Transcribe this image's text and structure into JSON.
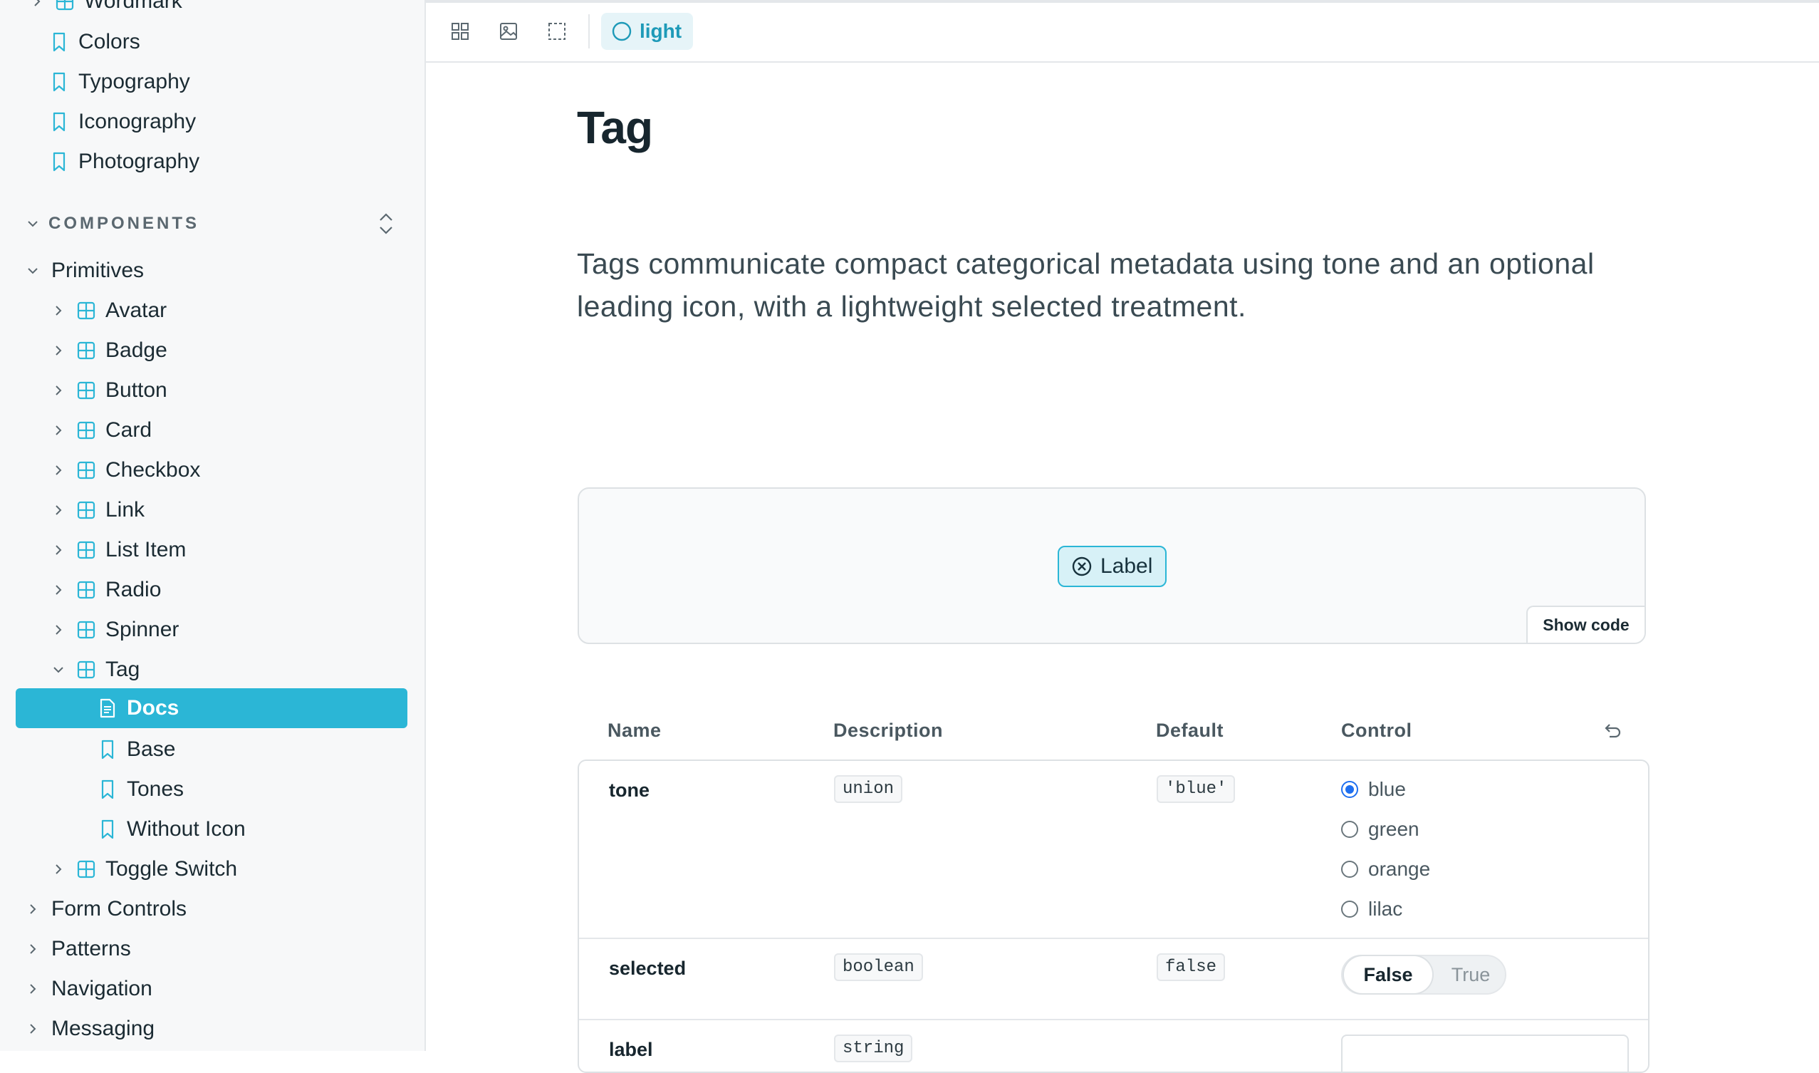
{
  "sidebar": {
    "top_items": [
      {
        "label": "Wordmark"
      },
      {
        "label": "Colors"
      },
      {
        "label": "Typography"
      },
      {
        "label": "Iconography"
      },
      {
        "label": "Photography"
      }
    ],
    "section_label": "COMPONENTS",
    "groups": [
      {
        "label": "Primitives"
      }
    ],
    "primitives": [
      {
        "label": "Avatar"
      },
      {
        "label": "Badge"
      },
      {
        "label": "Button"
      },
      {
        "label": "Card"
      },
      {
        "label": "Checkbox"
      },
      {
        "label": "Link"
      },
      {
        "label": "List Item"
      },
      {
        "label": "Radio"
      },
      {
        "label": "Spinner"
      },
      {
        "label": "Tag"
      }
    ],
    "tag_children": [
      {
        "label": "Docs"
      },
      {
        "label": "Base"
      },
      {
        "label": "Tones"
      },
      {
        "label": "Without Icon"
      }
    ],
    "after_tag": {
      "label": "Toggle Switch"
    },
    "bottom_groups": [
      {
        "label": "Form Controls"
      },
      {
        "label": "Patterns"
      },
      {
        "label": "Navigation"
      },
      {
        "label": "Messaging"
      }
    ]
  },
  "toolbar": {
    "theme_label": "light"
  },
  "main": {
    "title": "Tag",
    "description": "Tags communicate compact categorical metadata using tone and an optional leading icon, with a lightweight selected treatment.",
    "preview": {
      "tag_label": "Label",
      "show_code": "Show code"
    },
    "args_table": {
      "headers": {
        "name": "Name",
        "description": "Description",
        "default": "Default",
        "control": "Control"
      },
      "rows": [
        {
          "name": "tone",
          "type": "union",
          "default": "'blue'",
          "options": [
            "blue",
            "green",
            "orange",
            "lilac"
          ],
          "selected": "blue"
        },
        {
          "name": "selected",
          "type": "boolean",
          "default": "false",
          "toggle": {
            "on": "False",
            "off": "True"
          }
        },
        {
          "name": "label",
          "type": "string"
        }
      ]
    }
  },
  "colors": {
    "accent": "#2bb6d6",
    "radio_selected": "#1e6ff0"
  }
}
